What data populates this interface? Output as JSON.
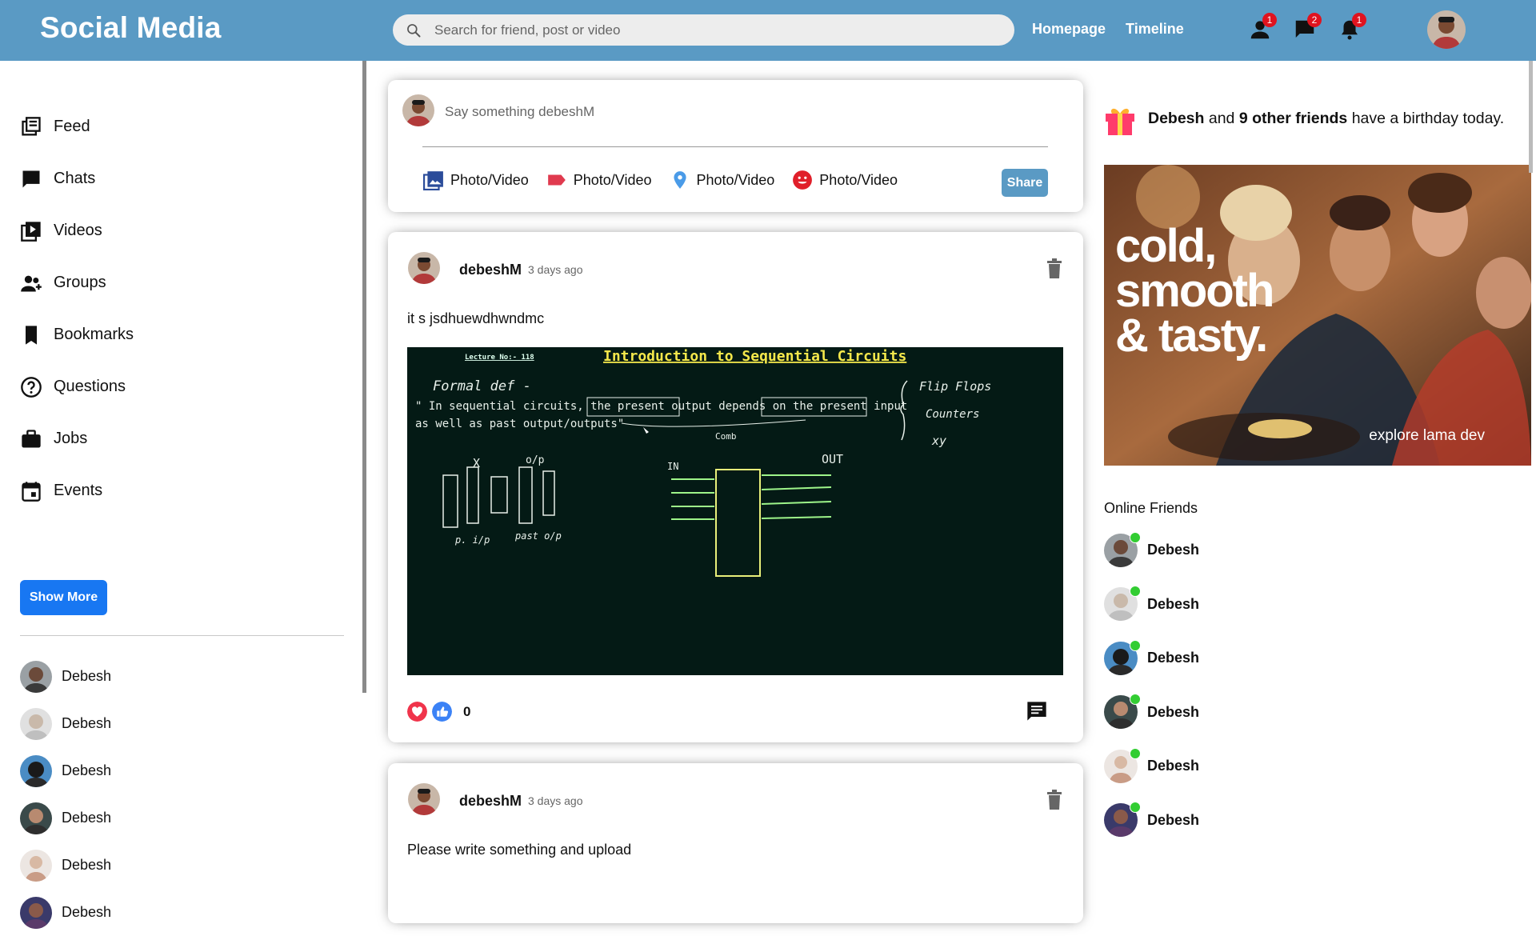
{
  "topbar": {
    "logo": "Social Media",
    "search_placeholder": "Search for friend, post or video",
    "links": [
      "Homepage",
      "Timeline"
    ],
    "badges": {
      "person": "1",
      "chat": "2",
      "notifications": "1"
    },
    "color": "#5a9ac4"
  },
  "sidebar": {
    "items": [
      {
        "label": "Feed",
        "icon": "feed-icon"
      },
      {
        "label": "Chats",
        "icon": "chat-icon"
      },
      {
        "label": "Videos",
        "icon": "video-icon"
      },
      {
        "label": "Groups",
        "icon": "group-icon"
      },
      {
        "label": "Bookmarks",
        "icon": "bookmark-icon"
      },
      {
        "label": "Questions",
        "icon": "question-icon"
      },
      {
        "label": "Jobs",
        "icon": "briefcase-icon"
      },
      {
        "label": "Events",
        "icon": "calendar-icon"
      }
    ],
    "show_more": "Show More",
    "friends": [
      "Debesh",
      "Debesh",
      "Debesh",
      "Debesh",
      "Debesh",
      "Debesh"
    ]
  },
  "share": {
    "placeholder": "Say something debeshM",
    "options": [
      "Photo/Video",
      "Photo/Video",
      "Photo/Video",
      "Photo/Video"
    ],
    "share_label": "Share"
  },
  "posts": [
    {
      "user": "debeshM",
      "date": "3 days ago",
      "text": "it s jsdhuewdhwndmc",
      "likes": "0",
      "image": {
        "lecture": "Lecture No:- 118",
        "title": "Introduction to Sequential Circuits",
        "formal": "Formal def -",
        "quote1": "\" In sequential circuits, the present output depends on the present input",
        "quote2": "as well as past output/outputs\"",
        "comb": "Comb",
        "side": [
          "Flip Flops",
          "Counters",
          "xy"
        ],
        "in": "IN",
        "out": "OUT"
      }
    },
    {
      "user": "debeshM",
      "date": "3 days ago",
      "text": "Please write something and upload"
    }
  ],
  "right": {
    "birthday_name": "Debesh",
    "birthday_and": " and ",
    "birthday_count": "9 other friends",
    "birthday_rest": " have a birthday today.",
    "ad_slogan": [
      "cold,",
      "smooth",
      "& tasty."
    ],
    "ad_footer": "explore lama dev",
    "online_title": "Online Friends",
    "online": [
      "Debesh",
      "Debesh",
      "Debesh",
      "Debesh",
      "Debesh",
      "Debesh"
    ]
  }
}
